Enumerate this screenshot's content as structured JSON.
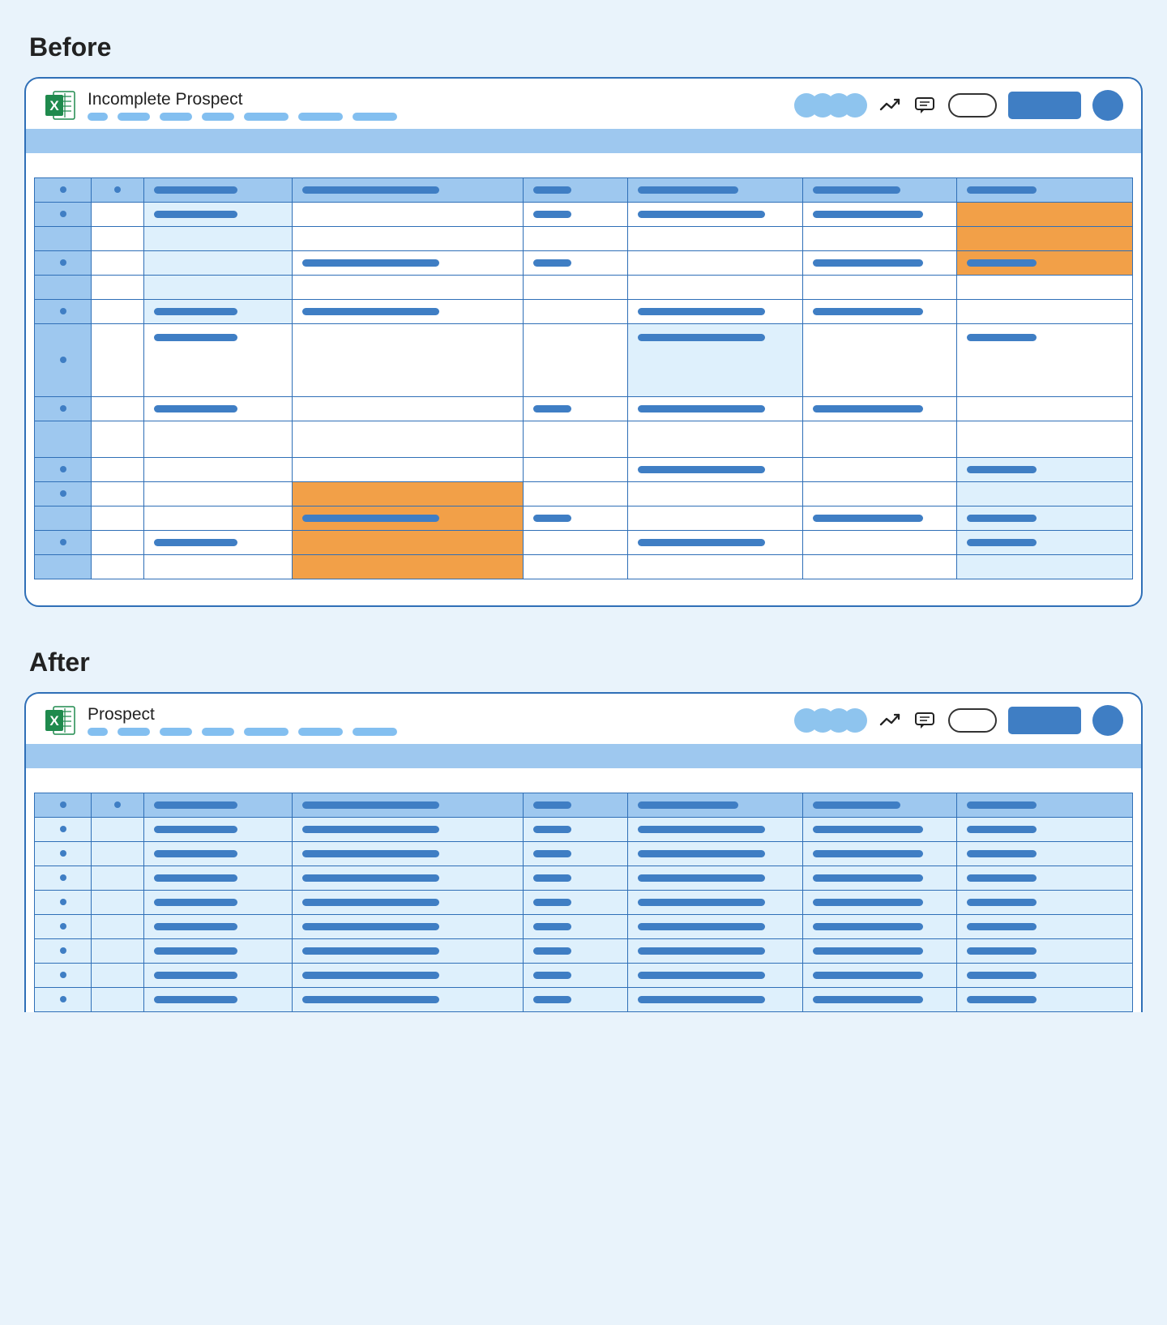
{
  "before": {
    "heading": "Before",
    "doc_title": "Incomplete Prospect",
    "breadcrumb_widths": [
      25,
      40,
      40,
      40,
      55,
      55,
      55
    ],
    "avatar_count": 4,
    "header_row": {
      "c1_dot": true,
      "c2_dot": true,
      "bars": [
        "m",
        "m",
        "s",
        "m",
        "m",
        "s"
      ]
    },
    "rows": [
      {
        "h": 1,
        "c1_dot": true,
        "c3": {
          "bg": "light",
          "bar": "m"
        },
        "c4": {},
        "c5": {
          "bar": "s"
        },
        "c6": {
          "bar": "l"
        },
        "c7": {
          "bar": "l"
        },
        "c8": {
          "bg": "warn"
        }
      },
      {
        "h": 1,
        "c3": {
          "bg": "light"
        },
        "c4": {},
        "c5": {},
        "c6": {},
        "c7": {},
        "c8": {
          "bg": "warn"
        }
      },
      {
        "h": 1,
        "c1_dot": true,
        "c3": {
          "bg": "light"
        },
        "c4": {
          "bar": "m"
        },
        "c5": {
          "bar": "s"
        },
        "c6": {},
        "c7": {
          "bar": "l"
        },
        "c8": {
          "bg": "warn",
          "bar": "s"
        }
      },
      {
        "h": 1,
        "c3": {
          "bg": "light"
        },
        "c4": {},
        "c5": {},
        "c6": {},
        "c7": {},
        "c8": {}
      },
      {
        "h": 1,
        "c1_dot": true,
        "c3": {
          "bg": "light",
          "bar": "m"
        },
        "c4": {
          "bar": "m"
        },
        "c5": {},
        "c6": {
          "bar": "l"
        },
        "c7": {
          "bar": "l"
        },
        "c8": {}
      },
      {
        "h": 3,
        "c1_dot": true,
        "c3": {
          "bar": "m",
          "vtop": true
        },
        "c4": {},
        "c5": {},
        "c6": {
          "bg": "light",
          "bar": "l",
          "vtop": true
        },
        "c7": {},
        "c8": {
          "bar": "s",
          "vtop": true
        }
      },
      {
        "h": 1,
        "c1_dot": true,
        "c3": {
          "bar": "m"
        },
        "c4": {},
        "c5": {
          "bar": "s"
        },
        "c6": {
          "bar": "l"
        },
        "c7": {
          "bar": "l"
        },
        "c8": {}
      },
      {
        "h": 1.5,
        "c3": {},
        "c4": {},
        "c5": {},
        "c6": {},
        "c7": {},
        "c8": {}
      },
      {
        "h": 1,
        "c1_dot": true,
        "c3": {},
        "c4": {},
        "c5": {},
        "c6": {
          "bar": "l"
        },
        "c7": {},
        "c8": {
          "bg": "light",
          "bar": "s"
        }
      },
      {
        "h": 1,
        "c1_dot": true,
        "c3": {},
        "c4": {
          "bg": "warn"
        },
        "c5": {},
        "c6": {},
        "c7": {},
        "c8": {
          "bg": "light"
        }
      },
      {
        "h": 1,
        "c3": {},
        "c4": {
          "bg": "warn",
          "bar": "m"
        },
        "c5": {
          "bar": "s"
        },
        "c6": {},
        "c7": {
          "bar": "l"
        },
        "c8": {
          "bg": "light",
          "bar": "s"
        }
      },
      {
        "h": 1,
        "c1_dot": true,
        "c3": {
          "bar": "m"
        },
        "c4": {
          "bg": "warn"
        },
        "c5": {},
        "c6": {
          "bar": "l"
        },
        "c7": {},
        "c8": {
          "bg": "light",
          "bar": "s"
        }
      },
      {
        "h": 1,
        "c3": {},
        "c4": {
          "bg": "warn"
        },
        "c5": {},
        "c6": {},
        "c7": {},
        "c8": {
          "bg": "light"
        }
      }
    ]
  },
  "after": {
    "heading": "After",
    "doc_title": "Prospect",
    "breadcrumb_widths": [
      25,
      40,
      40,
      40,
      55,
      55,
      55
    ],
    "avatar_count": 4,
    "header_row": {
      "c1_dot": true,
      "c2_dot": true,
      "bars": [
        "m",
        "m",
        "s",
        "m",
        "m",
        "s"
      ]
    },
    "row_count": 8,
    "row_bars": {
      "c3": "m",
      "c4": "m",
      "c5": "s",
      "c6": "l",
      "c7": "l",
      "c8": "s"
    }
  },
  "colors": {
    "page_bg": "#e9f3fb",
    "border": "#2f6fb7",
    "accent": "#3f7ec4",
    "header_fill": "#9ec8ef",
    "light_fill": "#def0fc",
    "warn_fill": "#f2a048",
    "avatar_fill": "#8ec4ee"
  }
}
